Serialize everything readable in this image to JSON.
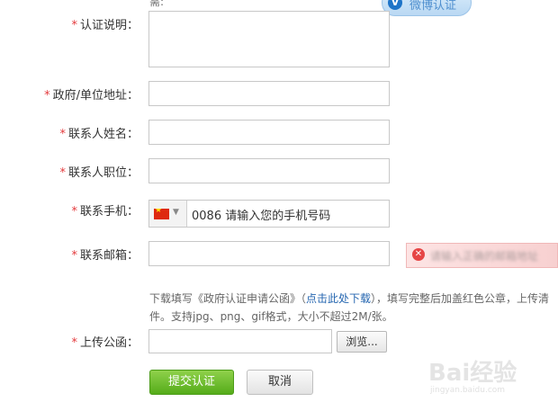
{
  "top_cut_text": "需:",
  "weibo_badge": {
    "label": "微博认证"
  },
  "fields": {
    "desc": {
      "required": "*",
      "label": "认证说明："
    },
    "address": {
      "required": "*",
      "label": "政府/单位地址："
    },
    "name": {
      "required": "*",
      "label": "联系人姓名："
    },
    "position": {
      "required": "*",
      "label": "联系人职位："
    },
    "phone": {
      "required": "*",
      "label": "联系手机：",
      "value": "0086 请输入您的手机号码"
    },
    "email": {
      "required": "*",
      "label": "联系邮箱：",
      "error": "请输入正确的邮箱地址"
    },
    "upload": {
      "required": "*",
      "label": "上传公函："
    }
  },
  "hint": {
    "prefix": "下载填写《政府认证申请公函》（",
    "link": "点击此处下载",
    "suffix": "），填写完整后加盖红色公章，上传清件。支持jpg、png、gif格式，大小不超过2M/张。"
  },
  "buttons": {
    "browse": "浏览...",
    "submit": "提交认证",
    "cancel": "取消"
  },
  "watermark": {
    "brand": "Bai经验",
    "url": "jingyan.baidu.com"
  },
  "colors": {
    "required": "#e4393c",
    "submit": "#55ac1a",
    "link": "#2566b0"
  }
}
